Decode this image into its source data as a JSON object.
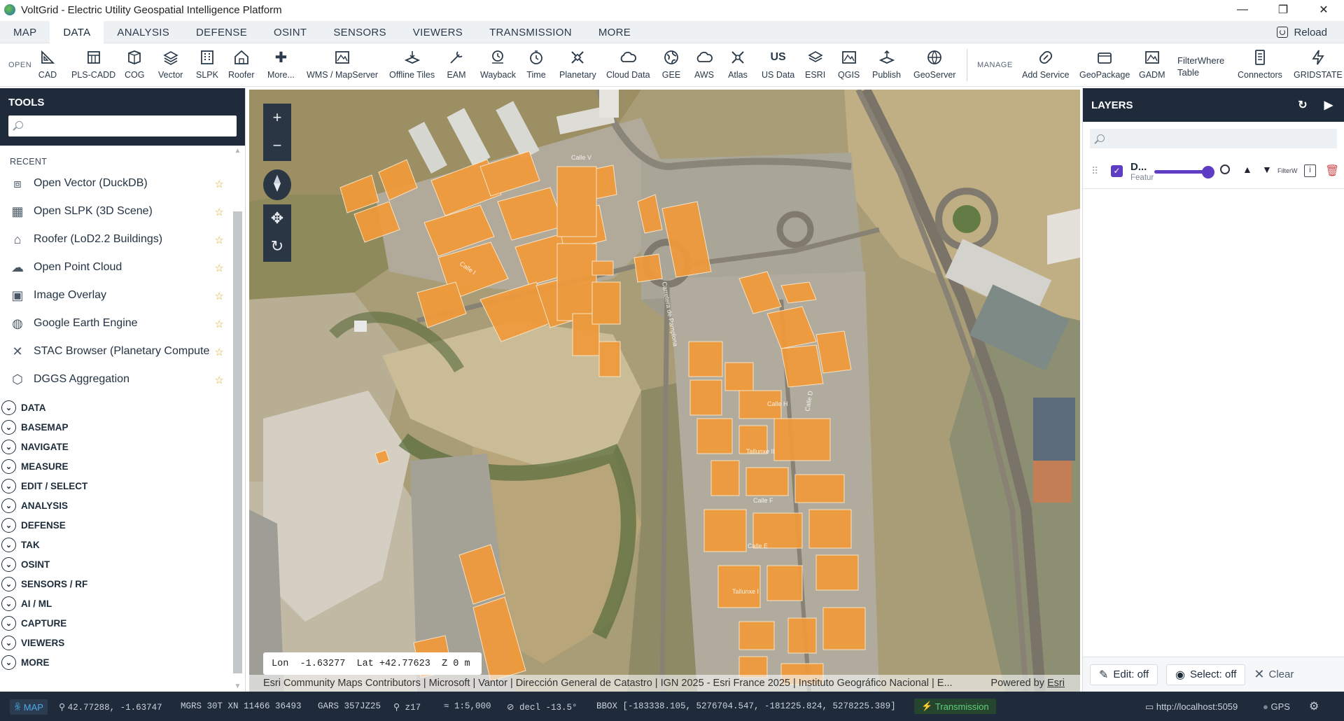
{
  "window": {
    "title": "VoltGrid - Electric Utility Geospatial Intelligence Platform",
    "minimize": "—",
    "restore": "❐",
    "close": "✕"
  },
  "menu": {
    "tabs": [
      "MAP",
      "DATA",
      "ANALYSIS",
      "DEFENSE",
      "OSINT",
      "SENSORS",
      "VIEWERS",
      "TRANSMISSION",
      "MORE"
    ],
    "active": "DATA",
    "reload": "Reload"
  },
  "ribbon": {
    "open_label": "OPEN",
    "manage_label": "MANAGE",
    "open_items": [
      {
        "label": "CAD",
        "icon": "cad-icon"
      },
      {
        "label": "PLS-CADD",
        "icon": "pls-cadd-icon"
      },
      {
        "label": "COG",
        "icon": "cog-icon"
      },
      {
        "label": "Vector",
        "icon": "vector-icon"
      },
      {
        "label": "SLPK",
        "icon": "slpk-icon"
      },
      {
        "label": "Roofer",
        "icon": "roofer-icon"
      },
      {
        "label": "More...",
        "icon": "plus-icon"
      },
      {
        "label": "WMS / MapServer",
        "icon": "wms-icon"
      },
      {
        "label": "Offline Tiles",
        "icon": "offline-tiles-icon"
      },
      {
        "label": "EAM",
        "icon": "eam-icon"
      },
      {
        "label": "Wayback",
        "icon": "wayback-icon"
      },
      {
        "label": "Time",
        "icon": "time-icon"
      },
      {
        "label": "Planetary",
        "icon": "planetary-icon"
      },
      {
        "label": "Cloud Data",
        "icon": "cloud-icon"
      },
      {
        "label": "GEE",
        "icon": "globe-icon"
      },
      {
        "label": "AWS",
        "icon": "aws-cloud-icon"
      },
      {
        "label": "Atlas",
        "icon": "atlas-icon"
      },
      {
        "label": "US Data",
        "icon": "us-icon"
      },
      {
        "label": "ESRI",
        "icon": "esri-icon"
      },
      {
        "label": "QGIS",
        "icon": "qgis-icon"
      },
      {
        "label": "Publish",
        "icon": "publish-icon"
      },
      {
        "label": "GeoServer",
        "icon": "geoserver-icon"
      }
    ],
    "manage_items": [
      {
        "label": "Add Service",
        "icon": "add-service-icon"
      },
      {
        "label": "GeoPackage",
        "icon": "geopackage-icon"
      },
      {
        "label": "GADM",
        "icon": "gadm-icon"
      },
      {
        "label": "Connectors",
        "icon": "connectors-icon"
      },
      {
        "label": "GRIDSTATE",
        "icon": "gridstate-icon"
      }
    ],
    "filterwhere": "FilterWhere",
    "filterwhere_sub": "Table",
    "us_glyph": "US"
  },
  "tools": {
    "title": "TOOLS",
    "search_placeholder": "",
    "recent_label": "RECENT",
    "recent": [
      {
        "label": "Open Vector (DuckDB)",
        "icon": "vector-icon"
      },
      {
        "label": "Open SLPK (3D Scene)",
        "icon": "slpk-icon"
      },
      {
        "label": "Roofer (LoD2.2 Buildings)",
        "icon": "roofer-icon"
      },
      {
        "label": "Open Point Cloud",
        "icon": "cloud-icon"
      },
      {
        "label": "Image Overlay",
        "icon": "image-icon"
      },
      {
        "label": "Google Earth Engine",
        "icon": "globe-icon"
      },
      {
        "label": "STAC Browser (Planetary Computer)",
        "icon": "planetary-icon"
      },
      {
        "label": "DGGS Aggregation",
        "icon": "hexagon-icon"
      }
    ],
    "sections": [
      "DATA",
      "BASEMAP",
      "NAVIGATE",
      "MEASURE",
      "EDIT / SELECT",
      "ANALYSIS",
      "DEFENSE",
      "TAK",
      "OSINT",
      "SENSORS / RF",
      "AI / ML",
      "CAPTURE",
      "VIEWERS",
      "MORE"
    ]
  },
  "map": {
    "coords": {
      "lon_label": "Lon",
      "lon": "-1.63277",
      "lat_label": "Lat",
      "lat": "+42.77623",
      "z_label": "Z",
      "z": "0 m"
    },
    "attribution": "Esri Community Maps Contributors | Microsoft | Vantor | Dirección General de Catastro | IGN 2025 - Esri France 2025 | Instituto Geográfico Nacional | E...",
    "powered_by": "Powered by",
    "powered_by_link": "Esri",
    "building_color": "#f29a3a",
    "street_labels": [
      "Calle V",
      "Calle I",
      "Calle H",
      "Calle F",
      "Calle E",
      "Calle D",
      "Carretera de Pamplona",
      "Tallunxe II",
      "Tallunxe I"
    ]
  },
  "layers": {
    "title": "LAYERS",
    "search_placeholder": "",
    "items": [
      {
        "name": "D...",
        "type": "Featur",
        "filter": "FilterW",
        "checked": true
      }
    ],
    "edit": "Edit: off",
    "select": "Select: off",
    "clear": "Clear",
    "accent": "#5e3cc4"
  },
  "status": {
    "mode": "MAP",
    "latlon": "42.77288, -1.63747",
    "mgrs": "MGRS 30T XN 11466 36493",
    "gars": "GARS 357JZ25",
    "zoom": "z17",
    "scale": "≈ 1:5,000",
    "decl": "decl -13.5°",
    "bbox": "BBOX [-183338.105, 5276704.547, -181225.824, 5278225.389]",
    "transmission": "Transmission",
    "server": "http://localhost:5059",
    "gps": "GPS"
  }
}
